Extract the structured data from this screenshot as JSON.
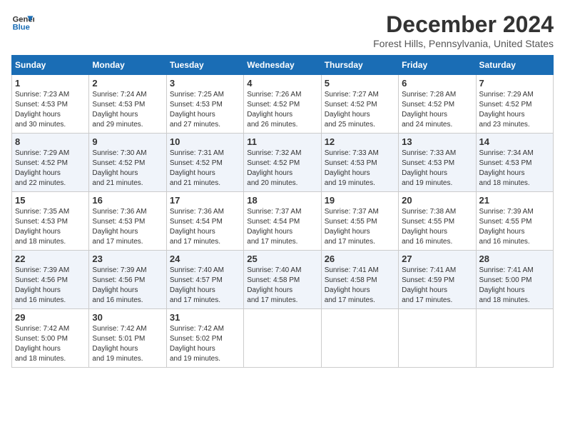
{
  "logo": {
    "line1": "General",
    "line2": "Blue"
  },
  "title": "December 2024",
  "location": "Forest Hills, Pennsylvania, United States",
  "days_header": [
    "Sunday",
    "Monday",
    "Tuesday",
    "Wednesday",
    "Thursday",
    "Friday",
    "Saturday"
  ],
  "weeks": [
    [
      {
        "day": "1",
        "sunrise": "7:23 AM",
        "sunset": "4:53 PM",
        "daylight": "9 hours and 30 minutes."
      },
      {
        "day": "2",
        "sunrise": "7:24 AM",
        "sunset": "4:53 PM",
        "daylight": "9 hours and 29 minutes."
      },
      {
        "day": "3",
        "sunrise": "7:25 AM",
        "sunset": "4:53 PM",
        "daylight": "9 hours and 27 minutes."
      },
      {
        "day": "4",
        "sunrise": "7:26 AM",
        "sunset": "4:52 PM",
        "daylight": "9 hours and 26 minutes."
      },
      {
        "day": "5",
        "sunrise": "7:27 AM",
        "sunset": "4:52 PM",
        "daylight": "9 hours and 25 minutes."
      },
      {
        "day": "6",
        "sunrise": "7:28 AM",
        "sunset": "4:52 PM",
        "daylight": "9 hours and 24 minutes."
      },
      {
        "day": "7",
        "sunrise": "7:29 AM",
        "sunset": "4:52 PM",
        "daylight": "9 hours and 23 minutes."
      }
    ],
    [
      {
        "day": "8",
        "sunrise": "7:29 AM",
        "sunset": "4:52 PM",
        "daylight": "9 hours and 22 minutes."
      },
      {
        "day": "9",
        "sunrise": "7:30 AM",
        "sunset": "4:52 PM",
        "daylight": "9 hours and 21 minutes."
      },
      {
        "day": "10",
        "sunrise": "7:31 AM",
        "sunset": "4:52 PM",
        "daylight": "9 hours and 21 minutes."
      },
      {
        "day": "11",
        "sunrise": "7:32 AM",
        "sunset": "4:52 PM",
        "daylight": "9 hours and 20 minutes."
      },
      {
        "day": "12",
        "sunrise": "7:33 AM",
        "sunset": "4:53 PM",
        "daylight": "9 hours and 19 minutes."
      },
      {
        "day": "13",
        "sunrise": "7:33 AM",
        "sunset": "4:53 PM",
        "daylight": "9 hours and 19 minutes."
      },
      {
        "day": "14",
        "sunrise": "7:34 AM",
        "sunset": "4:53 PM",
        "daylight": "9 hours and 18 minutes."
      }
    ],
    [
      {
        "day": "15",
        "sunrise": "7:35 AM",
        "sunset": "4:53 PM",
        "daylight": "9 hours and 18 minutes."
      },
      {
        "day": "16",
        "sunrise": "7:36 AM",
        "sunset": "4:53 PM",
        "daylight": "9 hours and 17 minutes."
      },
      {
        "day": "17",
        "sunrise": "7:36 AM",
        "sunset": "4:54 PM",
        "daylight": "9 hours and 17 minutes."
      },
      {
        "day": "18",
        "sunrise": "7:37 AM",
        "sunset": "4:54 PM",
        "daylight": "9 hours and 17 minutes."
      },
      {
        "day": "19",
        "sunrise": "7:37 AM",
        "sunset": "4:55 PM",
        "daylight": "9 hours and 17 minutes."
      },
      {
        "day": "20",
        "sunrise": "7:38 AM",
        "sunset": "4:55 PM",
        "daylight": "9 hours and 16 minutes."
      },
      {
        "day": "21",
        "sunrise": "7:39 AM",
        "sunset": "4:55 PM",
        "daylight": "9 hours and 16 minutes."
      }
    ],
    [
      {
        "day": "22",
        "sunrise": "7:39 AM",
        "sunset": "4:56 PM",
        "daylight": "9 hours and 16 minutes."
      },
      {
        "day": "23",
        "sunrise": "7:39 AM",
        "sunset": "4:56 PM",
        "daylight": "9 hours and 16 minutes."
      },
      {
        "day": "24",
        "sunrise": "7:40 AM",
        "sunset": "4:57 PM",
        "daylight": "9 hours and 17 minutes."
      },
      {
        "day": "25",
        "sunrise": "7:40 AM",
        "sunset": "4:58 PM",
        "daylight": "9 hours and 17 minutes."
      },
      {
        "day": "26",
        "sunrise": "7:41 AM",
        "sunset": "4:58 PM",
        "daylight": "9 hours and 17 minutes."
      },
      {
        "day": "27",
        "sunrise": "7:41 AM",
        "sunset": "4:59 PM",
        "daylight": "9 hours and 17 minutes."
      },
      {
        "day": "28",
        "sunrise": "7:41 AM",
        "sunset": "5:00 PM",
        "daylight": "9 hours and 18 minutes."
      }
    ],
    [
      {
        "day": "29",
        "sunrise": "7:42 AM",
        "sunset": "5:00 PM",
        "daylight": "9 hours and 18 minutes."
      },
      {
        "day": "30",
        "sunrise": "7:42 AM",
        "sunset": "5:01 PM",
        "daylight": "9 hours and 19 minutes."
      },
      {
        "day": "31",
        "sunrise": "7:42 AM",
        "sunset": "5:02 PM",
        "daylight": "9 hours and 19 minutes."
      },
      null,
      null,
      null,
      null
    ]
  ],
  "labels": {
    "sunrise": "Sunrise:",
    "sunset": "Sunset:",
    "daylight": "Daylight hours"
  }
}
